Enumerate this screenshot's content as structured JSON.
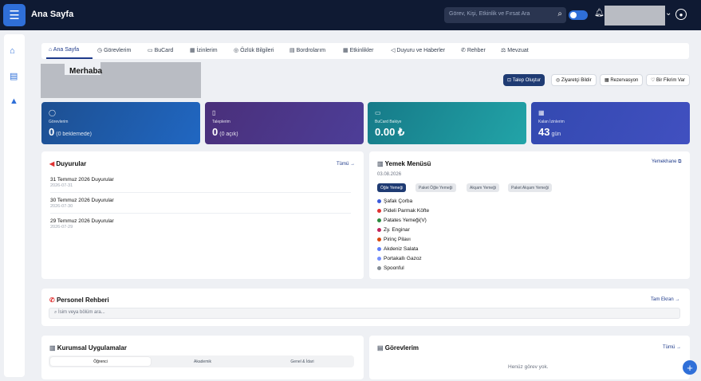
{
  "header": {
    "title": "Ana Sayfa",
    "search_placeholder": "Görev, Kişi, Etkinlik ve Fırsat Ara",
    "menu_icon": "hamburger-icon"
  },
  "tabs": [
    {
      "label": "Ana Sayfa",
      "icon": "home-icon"
    },
    {
      "label": "Görevlerim",
      "icon": "clock-icon"
    },
    {
      "label": "BuCard",
      "icon": "card-icon"
    },
    {
      "label": "İzinlerim",
      "icon": "calendar-icon"
    },
    {
      "label": "Özlük Bilgileri",
      "icon": "user-icon"
    },
    {
      "label": "Bordrolarım",
      "icon": "document-icon"
    },
    {
      "label": "Etkinlikler",
      "icon": "calendar-icon"
    },
    {
      "label": "Duyuru ve Haberler",
      "icon": "megaphone-icon"
    },
    {
      "label": "Rehber",
      "icon": "phone-icon"
    },
    {
      "label": "Mevzuat",
      "icon": "scale-icon"
    }
  ],
  "greeting": "Merhaba",
  "quick_actions": [
    "Talep Oluştur",
    "Ziyaretçi Bildir",
    "Rezervasyon",
    "Bir Fikrim Var"
  ],
  "stats": [
    {
      "label": "Görevlerim",
      "value": "0",
      "sub": "(0 beklemede)",
      "color": "#1e5fae"
    },
    {
      "label": "Taleplerim",
      "value": "0",
      "sub": "(0 açık)",
      "color": "#4a3a88"
    },
    {
      "label": "BuCard Bakiye",
      "value": "0.00 ₺",
      "sub": "",
      "color": "#1e9aa3"
    },
    {
      "label": "Kalan İzinlerim",
      "value": "43",
      "sub": "gün",
      "color": "#3b4db8"
    }
  ],
  "announcements": {
    "title": "Duyurular",
    "link": "Tümü →",
    "items": [
      {
        "title": "31 Temmuz 2026 Duyurular",
        "date": "2026-07-31"
      },
      {
        "title": "30 Temmuz 2026 Duyurular",
        "date": "2026-07-30"
      },
      {
        "title": "29 Temmuz 2026 Duyurular",
        "date": "2026-07-29"
      }
    ]
  },
  "menu": {
    "title": "Yemek Menüsü",
    "link": "Yemekhane ⧉",
    "date": "03.08.2026",
    "chips": [
      "Öğle Yemeği",
      "Paket Öğle Yemeği",
      "Akşam Yemeği",
      "Paket Akşam Yemeği"
    ],
    "items": [
      {
        "name": "Şafak Çorba",
        "color": "#3b5bdb"
      },
      {
        "name": "Pideli Parmak Köfte",
        "color": "#e03131"
      },
      {
        "name": "Patates Yemeği(V)",
        "color": "#2b8a3e"
      },
      {
        "name": "Zy. Enginar",
        "color": "#c2255c"
      },
      {
        "name": "Pirinç Pilavı",
        "color": "#d9480f"
      },
      {
        "name": "Akdeniz Salata",
        "color": "#5c7cfa"
      },
      {
        "name": "Portakallı Gazoz",
        "color": "#748ffc"
      },
      {
        "name": "Spoonful",
        "color": "#868e96"
      }
    ]
  },
  "directory": {
    "title": "Personel Rehberi",
    "link": "Tam Ekran →",
    "placeholder": "İsim veya bölüm ara..."
  },
  "apps": {
    "title": "Kurumsal Uygulamalar",
    "segments": [
      "Öğrenci",
      "Akademik",
      "Genel & İdari"
    ]
  },
  "tasks": {
    "title": "Görevlerim",
    "link": "Tümü →",
    "empty": "Henüz görev yok."
  }
}
